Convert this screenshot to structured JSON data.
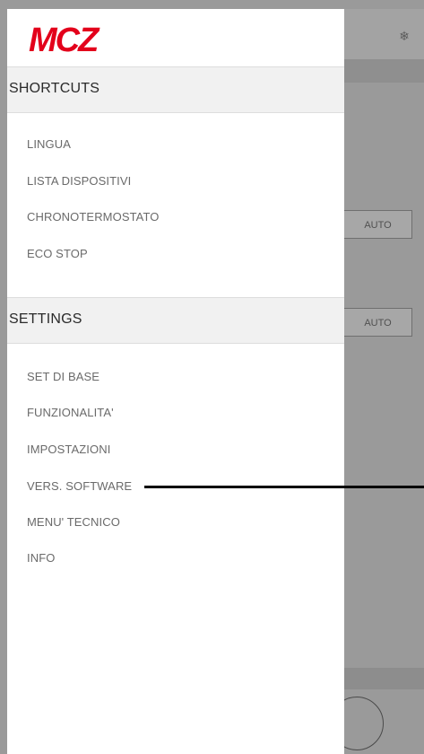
{
  "background": {
    "mode_buttons": [
      "AUTO",
      "AUTO"
    ],
    "top_icon": "snowflake-icon"
  },
  "drawer": {
    "brand": "MCZ",
    "brand_color": "#e3001b",
    "sections": [
      {
        "title": "SHORTCUTS",
        "items": [
          "LINGUA",
          "LISTA DISPOSITIVI",
          "CHRONOTERMOSTATO",
          "ECO STOP"
        ]
      },
      {
        "title": "SETTINGS",
        "items": [
          "SET DI BASE",
          "FUNZIONALITA'",
          "IMPOSTAZIONI",
          "VERS. SOFTWARE",
          "MENU' TECNICO",
          "INFO"
        ]
      }
    ]
  },
  "colors": {
    "header_bg": "#f1f1f1",
    "item_text": "#6a6a6a",
    "overlay": "#9a9a9a"
  }
}
